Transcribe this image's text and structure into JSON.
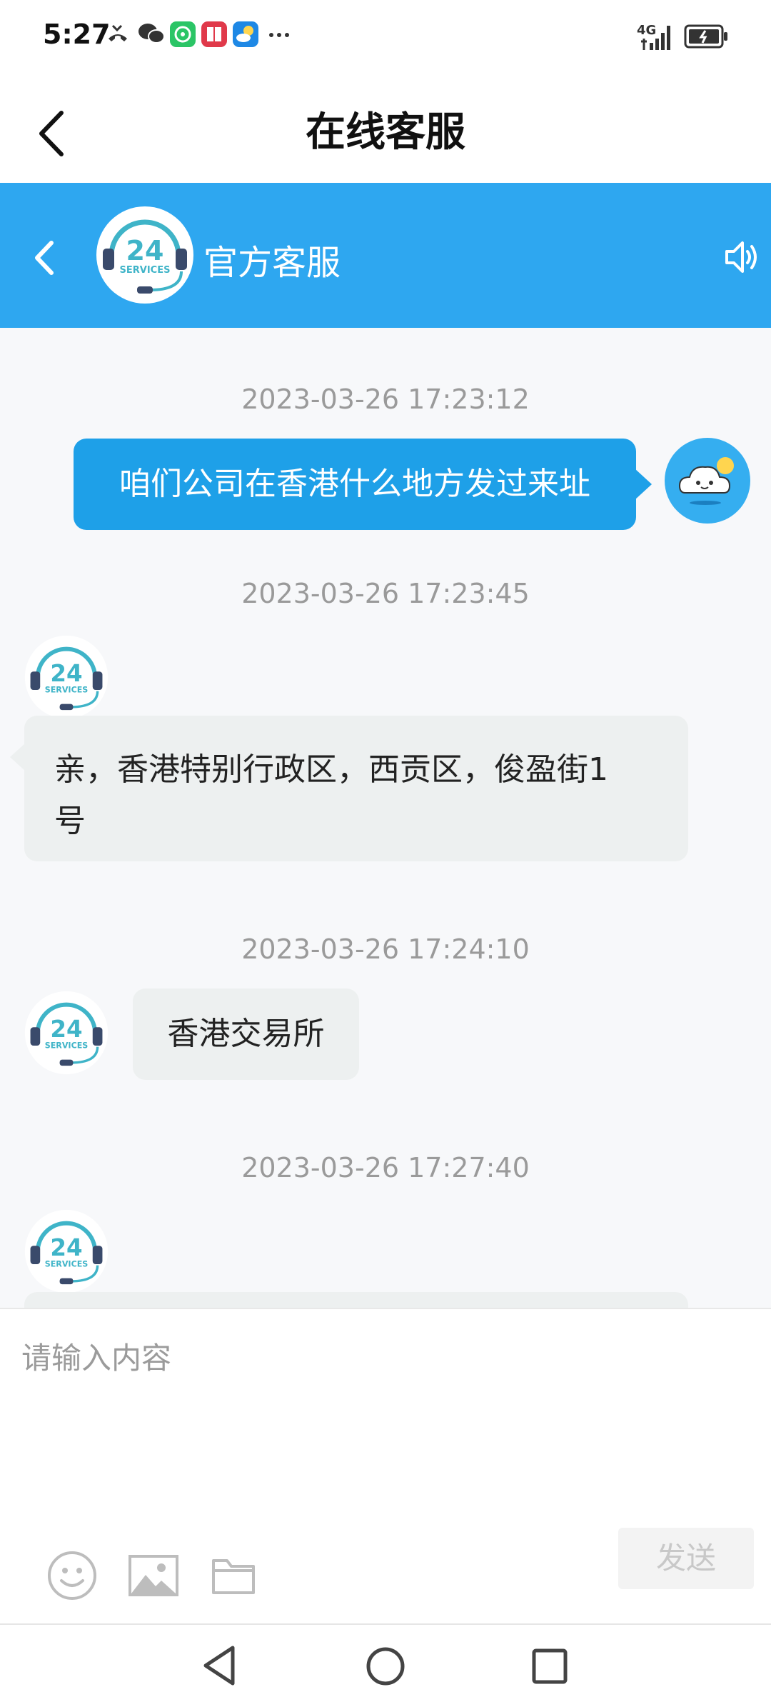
{
  "status_bar": {
    "time": "5:27",
    "network": "4G",
    "icons": [
      "missed-call-icon",
      "wechat-icon",
      "messaging-app-icon",
      "book-app-icon",
      "weather-app-icon",
      "more-notifications-icon",
      "signal-icon",
      "battery-icon"
    ]
  },
  "page": {
    "title": "在线客服"
  },
  "chat_header": {
    "agent_name": "官方客服",
    "avatar_text_top": "24",
    "avatar_text_bottom": "SERVICES"
  },
  "colors": {
    "header_blue": "#2ea7f0",
    "user_bubble": "#1ea0e8",
    "agent_bubble": "#edf0f0"
  },
  "messages": [
    {
      "sender": "user",
      "timestamp": "2023-03-26 17:23:12",
      "text": "咱们公司在香港什么地方发过来址"
    },
    {
      "sender": "agent",
      "timestamp": "2023-03-26 17:23:45",
      "text_line1": "亲，香港特别行政区，西贡区，俊盈街1",
      "text_line2": "号"
    },
    {
      "sender": "agent",
      "timestamp": "2023-03-26 17:24:10",
      "text": "香港交易所"
    },
    {
      "sender": "agent",
      "timestamp": "2023-03-26 17:27:40",
      "text": ""
    }
  ],
  "input": {
    "placeholder": "请输入内容",
    "value": "",
    "send_label": "发送"
  },
  "toolbar_icons": [
    "emoji-icon",
    "image-icon",
    "folder-icon"
  ],
  "nav_bar": [
    "back-nav-icon",
    "home-nav-icon",
    "recents-nav-icon"
  ]
}
